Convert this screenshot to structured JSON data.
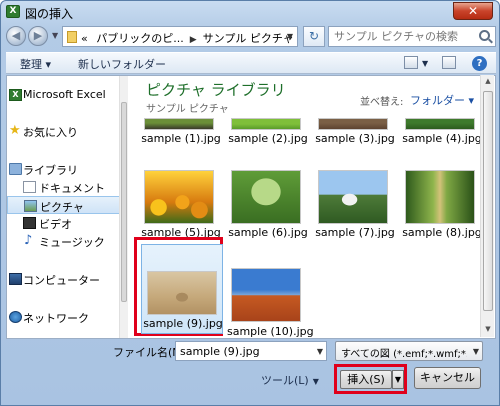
{
  "window": {
    "title": "図の挿入",
    "close_symbol": "✕"
  },
  "nav": {
    "back_symbol": "◀",
    "forward_symbol": "▶",
    "breadcrumb_prefix": "«",
    "crumb_1": "パブリックのピ...",
    "crumb_2": "サンプル ピクチャ",
    "search_placeholder": "サンプル ピクチャの検索"
  },
  "toolbar": {
    "organize_label": "整理 ▾",
    "new_folder_label": "新しいフォルダー",
    "help_symbol": "?"
  },
  "sidebar": {
    "items": [
      {
        "label": "Microsoft Excel"
      },
      {
        "label": "お気に入り"
      },
      {
        "label": "ライブラリ"
      },
      {
        "label": "ドキュメント"
      },
      {
        "label": "ピクチャ"
      },
      {
        "label": "ビデオ"
      },
      {
        "label": "ミュージック"
      },
      {
        "label": "コンピューター"
      },
      {
        "label": "ネットワーク"
      }
    ]
  },
  "library": {
    "title": "ピクチャ ライブラリ",
    "subtitle": "サンプル ピクチャ",
    "arrange_label": "並べ替え:",
    "arrange_value": "フォルダー ▾"
  },
  "files": [
    {
      "name": "sample (1).jpg"
    },
    {
      "name": "sample (2).jpg"
    },
    {
      "name": "sample (3).jpg"
    },
    {
      "name": "sample (4).jpg"
    },
    {
      "name": "sample (5).jpg"
    },
    {
      "name": "sample (6).jpg"
    },
    {
      "name": "sample (7).jpg"
    },
    {
      "name": "sample (8).jpg"
    },
    {
      "name": "sample (9).jpg"
    },
    {
      "name": "sample (10).jpg"
    }
  ],
  "bottom": {
    "filename_label": "ファイル名(N):",
    "filename_value": "sample (9).jpg",
    "filter_value": "すべての図 (*.emf;*.wmf;*.j",
    "tools_label": "ツール(L)",
    "insert_label": "挿入(S)",
    "cancel_label": "キャンセル"
  }
}
